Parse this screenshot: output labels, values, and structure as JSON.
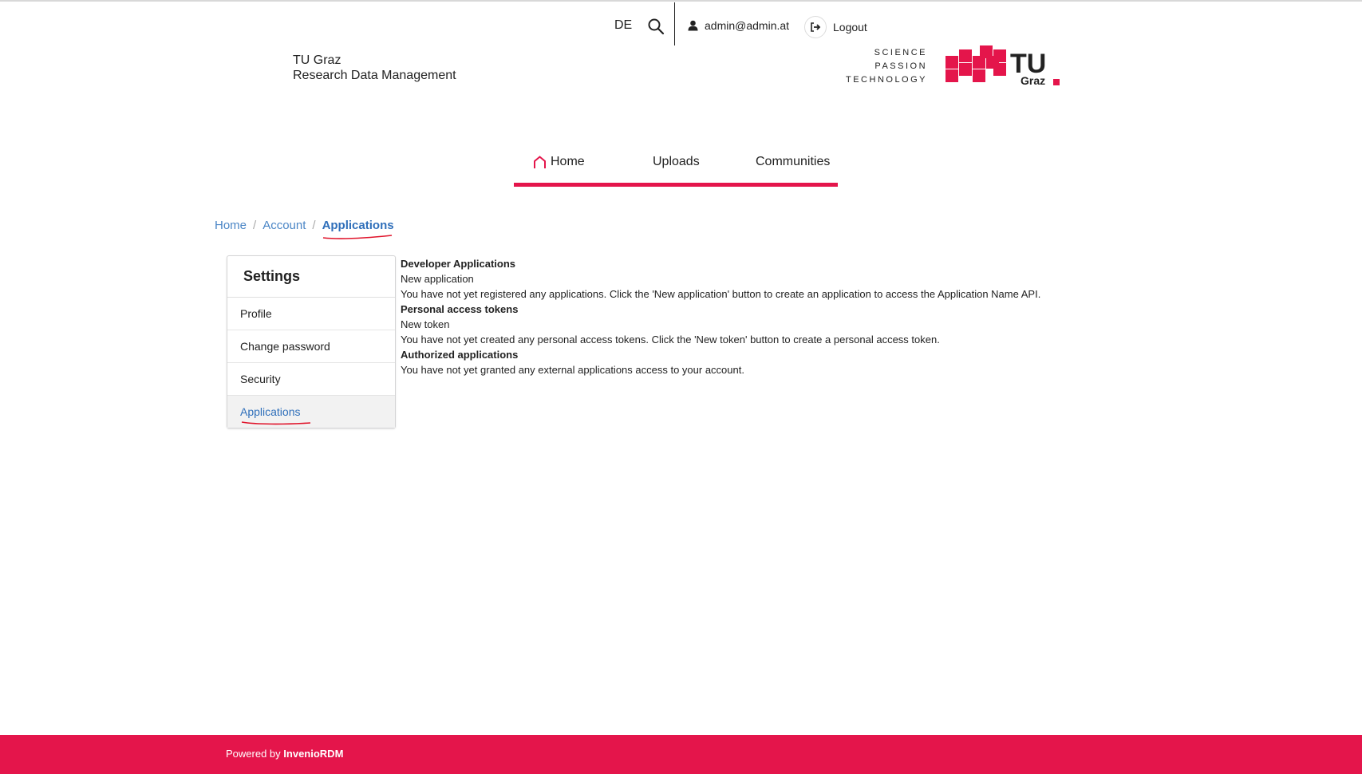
{
  "header": {
    "language": "DE",
    "user_email": "admin@admin.at",
    "logout_label": "Logout",
    "brand_line1": "TU Graz",
    "brand_line2": "Research Data Management",
    "tagline": [
      "SCIENCE",
      "PASSION",
      "TECHNOLOGY"
    ],
    "logo_text_1": "TU",
    "logo_text_2": "Graz"
  },
  "nav": {
    "items": [
      {
        "label": "Home",
        "icon": "home-icon"
      },
      {
        "label": "Uploads"
      },
      {
        "label": "Communities"
      }
    ]
  },
  "breadcrumb": {
    "items": [
      "Home",
      "Account"
    ],
    "active": "Applications"
  },
  "settings": {
    "title": "Settings",
    "items": [
      "Profile",
      "Change password",
      "Security",
      "Applications"
    ],
    "active": "Applications"
  },
  "content": {
    "dev_apps_heading": "Developer Applications",
    "new_application_label": "New application",
    "dev_apps_empty": "You have not yet registered any applications. Click the 'New application' button to create an application to access the Application Name API.",
    "tokens_heading": "Personal access tokens",
    "new_token_label": "New token",
    "tokens_empty": "You have not yet created any personal access tokens. Click the 'New token' button to create a personal access token.",
    "authorized_heading": "Authorized applications",
    "authorized_empty": "You have not yet granted any external applications access to your account."
  },
  "footer": {
    "powered_by": "Powered by",
    "product": "InvenioRDM"
  },
  "colors": {
    "accent": "#e4154b",
    "link": "#4b86c6"
  }
}
